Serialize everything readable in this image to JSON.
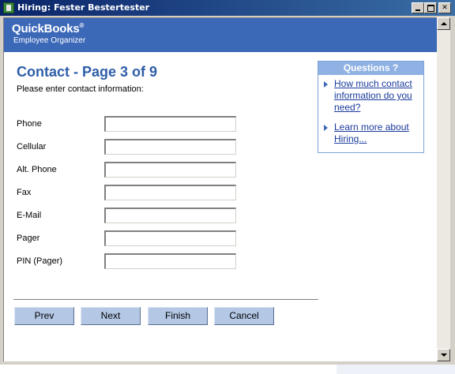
{
  "window": {
    "title": "Hiring: Fester Bestertester"
  },
  "banner": {
    "brand": "QuickBooks",
    "brand_mark": "®",
    "subtitle": "Employee Organizer"
  },
  "page": {
    "heading": "Contact - Page 3 of 9",
    "instructions": "Please enter contact information:"
  },
  "fields": [
    {
      "label": "Phone",
      "value": ""
    },
    {
      "label": "Cellular",
      "value": ""
    },
    {
      "label": "Alt. Phone",
      "value": ""
    },
    {
      "label": "Fax",
      "value": ""
    },
    {
      "label": "E-Mail",
      "value": ""
    },
    {
      "label": "Pager",
      "value": ""
    },
    {
      "label": "PIN (Pager)",
      "value": ""
    }
  ],
  "questions": {
    "title": "Questions ?",
    "links": [
      {
        "text": "How much contact information do you need?"
      },
      {
        "text": "Learn more about Hiring..."
      }
    ]
  },
  "buttons": {
    "prev": "Prev",
    "next": "Next",
    "finish": "Finish",
    "cancel": "Cancel"
  },
  "colors": {
    "banner": "#3c68b8",
    "heading": "#2f5ea8",
    "button": "#b4c8e6",
    "question_header": "#8fb1e3"
  },
  "icons": {
    "app": "hiring-app-icon",
    "minimize": "minimize-icon",
    "maximize": "maximize-icon",
    "close": "close-icon",
    "link_bullet": "triangle-right-icon"
  }
}
